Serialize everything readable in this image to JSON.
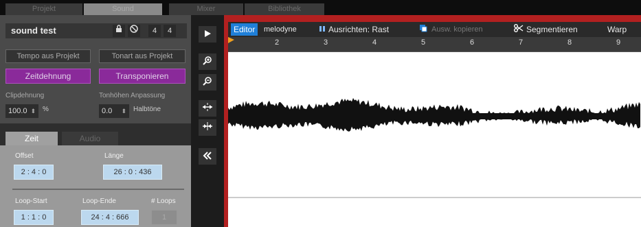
{
  "top_tabs": [
    {
      "label": "Projekt",
      "active": false
    },
    {
      "label": "Sound",
      "active": true
    },
    {
      "label": "Mixer",
      "active": false
    },
    {
      "label": "Bibliothek",
      "active": false
    }
  ],
  "clip": {
    "name": "sound test",
    "lock_icon": "lock-icon",
    "stop_icon": "stop-icon",
    "time_sig_num": "4",
    "time_sig_den": "4"
  },
  "tempo": {
    "header": "Tempo aus Projekt",
    "button": "Zeitdehnung",
    "label": "Clipdehnung",
    "value": "100.0",
    "unit": "%"
  },
  "key": {
    "header": "Tonart aus Projekt",
    "button": "Transponieren",
    "label": "Tonhöhen Anpassung",
    "value": "0.0",
    "unit": "Halbtöne"
  },
  "lower_tabs": [
    {
      "label": "Zeit",
      "active": true
    },
    {
      "label": "Audio",
      "active": false
    }
  ],
  "time": {
    "offset_label": "Offset",
    "offset_value": "2 : 4 : 0",
    "length_label": "Länge",
    "length_value": "26 : 0 : 436",
    "loop_start_label": "Loop-Start",
    "loop_start_value": "1 : 1 : 0",
    "loop_end_label": "Loop-Ende",
    "loop_end_value": "24 : 4 : 666",
    "loops_label": "# Loops",
    "loops_value": "1"
  },
  "tools": [
    "play-icon",
    "zoom-in-icon",
    "zoom-out-icon",
    "expand-horizontal-icon",
    "shrink-horizontal-icon",
    "collapse-left-icon"
  ],
  "toolbar": {
    "editor": "Editor",
    "melodyne": "melodyne",
    "align_icon": "pause-icon",
    "align": "Ausrichten: Rast",
    "copy_icon": "copy-icon",
    "copy": "Ausw. kopieren",
    "segment_icon": "scissors-icon",
    "segment": "Segmentieren",
    "warp": "Warp"
  },
  "ruler": [
    "2",
    "3",
    "4",
    "5",
    "6",
    "7",
    "8",
    "9"
  ],
  "colors": {
    "editor_tab": "#1f7fd8",
    "purple_button": "#8a2a9a",
    "value_field": "#bcd8ee",
    "editor_frame": "#b22020"
  }
}
